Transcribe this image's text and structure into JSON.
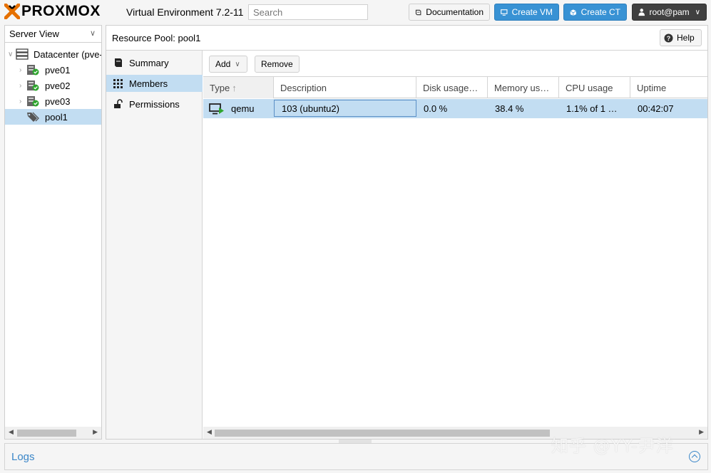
{
  "header": {
    "logo_text": "PROXMOX",
    "title": "Virtual Environment 7.2-11",
    "search_placeholder": "Search",
    "doc_label": "Documentation",
    "create_vm_label": "Create VM",
    "create_ct_label": "Create CT",
    "user_label": "root@pam"
  },
  "sidebar": {
    "view_label": "Server View",
    "tree": [
      {
        "label": "Datacenter (pve-",
        "type": "datacenter"
      },
      {
        "label": "pve01",
        "type": "node"
      },
      {
        "label": "pve02",
        "type": "node"
      },
      {
        "label": "pve03",
        "type": "node"
      },
      {
        "label": "pool1",
        "type": "pool",
        "selected": true
      }
    ]
  },
  "main": {
    "title": "Resource Pool: pool1",
    "help_label": "Help",
    "nav": [
      {
        "label": "Summary",
        "icon": "book-icon"
      },
      {
        "label": "Members",
        "icon": "grid-icon",
        "selected": true
      },
      {
        "label": "Permissions",
        "icon": "unlock-icon"
      }
    ],
    "toolbar": {
      "add_label": "Add",
      "remove_label": "Remove"
    },
    "grid": {
      "columns": [
        "Type",
        "Description",
        "Disk usage…",
        "Memory us…",
        "CPU usage",
        "Uptime"
      ],
      "sort_indicator": "↑",
      "rows": [
        {
          "type": "qemu",
          "description": "103 (ubuntu2)",
          "disk": "0.0 %",
          "memory": "38.4 %",
          "cpu": "1.1% of 1 …",
          "uptime": "00:42:07"
        }
      ]
    }
  },
  "logs": {
    "label": "Logs"
  },
  "watermark": "知乎 @YY-尹洋",
  "colors": {
    "accent": "#3892d4",
    "selection": "#c2ddf2",
    "logo_x": "#e57000",
    "status_ok": "#2ea52e"
  }
}
